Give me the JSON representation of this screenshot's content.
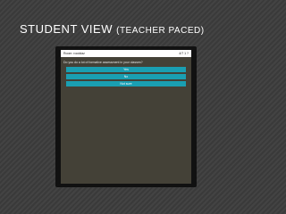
{
  "slide": {
    "title_main": "STUDENT VIEW ",
    "title_sub": "(TEACHER PACED)"
  },
  "app": {
    "room_name": "Room: rooddaz",
    "progress": "4/7 1 ?",
    "question": "Do you do a lot of formative assessment in your classes?",
    "answers": [
      "Yes",
      "No",
      "Not sure"
    ]
  }
}
